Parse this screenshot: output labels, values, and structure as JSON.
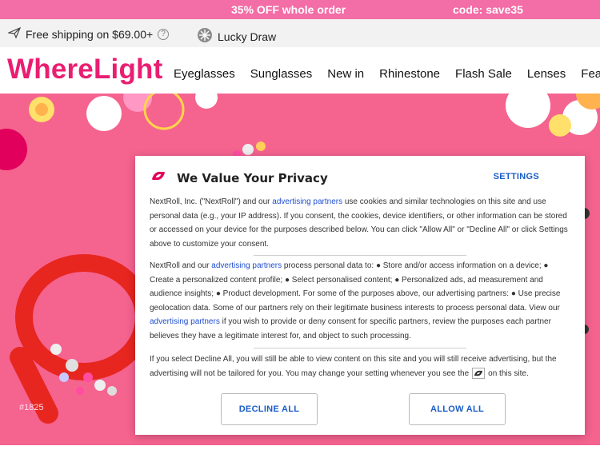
{
  "promo": {
    "offer": "35% OFF whole order",
    "code": "code: save35"
  },
  "infobar": {
    "shipping": "Free shipping on $69.00+",
    "help": "?",
    "lucky": "Lucky Draw",
    "icons": [
      "plane-icon",
      "snowflake-icon",
      "question-icon"
    ]
  },
  "brand": {
    "logo": "WhereLight",
    "color": "#e91e72"
  },
  "nav": {
    "items": [
      "Eyeglasses",
      "Sunglasses",
      "New in",
      "Rhinestone",
      "Flash Sale",
      "Lenses",
      "Featured"
    ]
  },
  "hero": {
    "code": "#1825",
    "background": "#f5638f"
  },
  "consent": {
    "title": "We Value Your Privacy",
    "settings": "SETTINGS",
    "p1_a": "NextRoll, Inc. (\"NextRoll\") and our ",
    "p1_link": "advertising partners",
    "p1_b": " use cookies and similar technologies on this site and use personal data (e.g., your IP address). If you consent, the cookies, device identifiers, or other information can be stored or accessed on your device for the purposes described below. You can click \"Allow All\" or \"Decline All\" or click Settings above to customize your consent.",
    "p2_a": "NextRoll and our ",
    "p2_link1": "advertising partners",
    "p2_b": " process personal data to: ● Store and/or access information on a device; ● Create a personalized content profile; ● Select personalised content; ● Personalized ads, ad measurement and audience insights; ● Product development. For some of the purposes above, our advertising partners: ● Use precise geolocation data. Some of our partners rely on their legitimate business interests to process personal data. View our ",
    "p2_link2": "advertising partners",
    "p2_c": " if you wish to provide or deny consent for specific partners, review the purposes each partner believes they have a legitimate interest for, and object to such processing.",
    "p3_a": "If you select Decline All, you will still be able to view content on this site and you will still receive advertising, but the advertising will not be tailored for you. You may change your setting whenever you see the",
    "p3_b": "on this site.",
    "decline": "DECLINE ALL",
    "allow": "ALLOW ALL",
    "accent": "#1a5dc7",
    "logo_color": "#e2005a"
  }
}
